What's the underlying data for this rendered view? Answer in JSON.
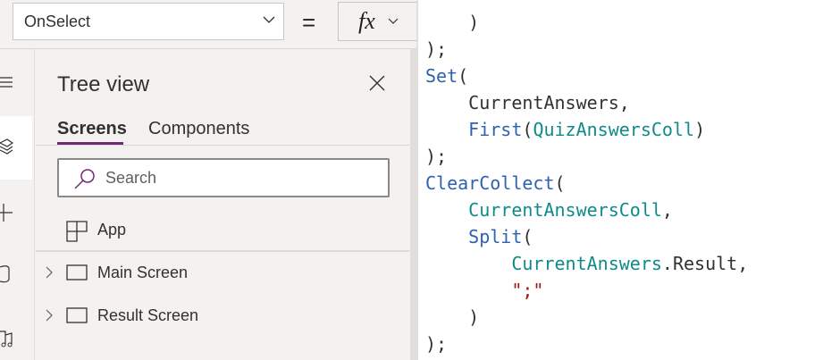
{
  "formula_bar": {
    "property": "OnSelect",
    "equals": "=",
    "fx_label": "fx"
  },
  "tree_view": {
    "title": "Tree view",
    "tabs": [
      {
        "label": "Screens",
        "active": true
      },
      {
        "label": "Components",
        "active": false
      }
    ],
    "search_placeholder": "Search",
    "items": [
      {
        "label": "App",
        "icon": "app-grid-icon"
      },
      {
        "label": "Main Screen",
        "icon": "screen-icon"
      },
      {
        "label": "Result Screen",
        "icon": "screen-icon"
      }
    ]
  },
  "colors": {
    "accent": "#742774",
    "function": "#2e62b0",
    "identifier": "#0f8a8a",
    "string": "#a31515"
  },
  "code_lines": [
    [
      {
        "t": "plain",
        "v": "    )"
      }
    ],
    [
      {
        "t": "plain",
        "v": ");"
      }
    ],
    [
      {
        "t": "fn",
        "v": "Set"
      },
      {
        "t": "plain",
        "v": "("
      }
    ],
    [
      {
        "t": "plain",
        "v": "    CurrentAnswers,"
      }
    ],
    [
      {
        "t": "plain",
        "v": "    "
      },
      {
        "t": "fn",
        "v": "First"
      },
      {
        "t": "plain",
        "v": "("
      },
      {
        "t": "id",
        "v": "QuizAnswersColl"
      },
      {
        "t": "plain",
        "v": ")"
      }
    ],
    [
      {
        "t": "plain",
        "v": ");"
      }
    ],
    [
      {
        "t": "fn",
        "v": "ClearCollect"
      },
      {
        "t": "plain",
        "v": "("
      }
    ],
    [
      {
        "t": "plain",
        "v": "    "
      },
      {
        "t": "id",
        "v": "CurrentAnswersColl"
      },
      {
        "t": "plain",
        "v": ","
      }
    ],
    [
      {
        "t": "plain",
        "v": "    "
      },
      {
        "t": "fn",
        "v": "Split"
      },
      {
        "t": "plain",
        "v": "("
      }
    ],
    [
      {
        "t": "plain",
        "v": "        "
      },
      {
        "t": "id",
        "v": "CurrentAnswers"
      },
      {
        "t": "plain",
        "v": ".Result,"
      }
    ],
    [
      {
        "t": "plain",
        "v": "        "
      },
      {
        "t": "str",
        "v": "\";\""
      }
    ],
    [
      {
        "t": "plain",
        "v": "    )"
      }
    ],
    [
      {
        "t": "plain",
        "v": ");"
      }
    ]
  ]
}
